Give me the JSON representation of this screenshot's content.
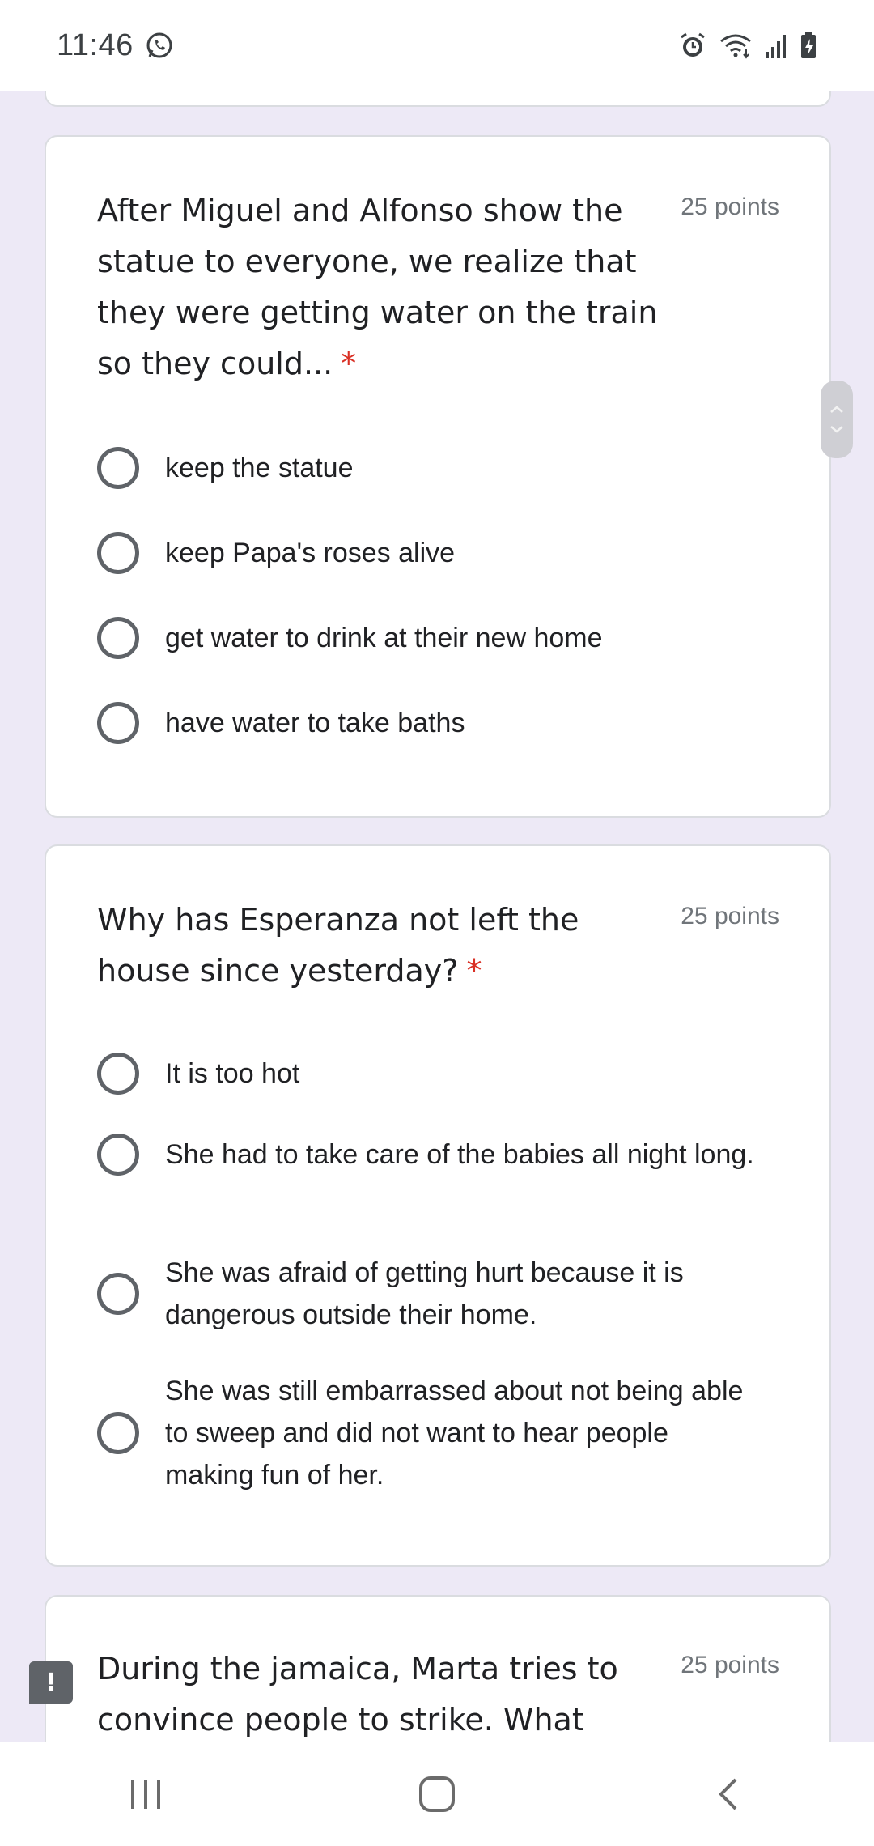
{
  "status_bar": {
    "time": "11:46",
    "left_icons": [
      "whatsapp-icon"
    ],
    "right_icons": [
      "alarm-icon",
      "wifi-icon",
      "signal-icon",
      "battery-charging-icon"
    ]
  },
  "questions": [
    {
      "title": "After Miguel and Alfonso show the statue to everyone, we realize that they were getting water on the train so they could...",
      "required_mark": "*",
      "points": "25 points",
      "options": [
        "keep the statue",
        "keep Papa's roses alive",
        "get water to drink at their new home",
        "have water to take baths"
      ]
    },
    {
      "title": "Why has Esperanza not left the house since yesterday?",
      "required_mark": "*",
      "points": "25 points",
      "options": [
        "It is too hot",
        "She had to take care of the babies all night long.",
        "She was afraid of getting hurt because it is dangerous outside their home.",
        "She was still embarrassed about not being able to sweep and did not want to hear people making fun of her."
      ]
    },
    {
      "title": "During the jamaica, Marta tries to convince people to strike. What",
      "points": "25 points"
    }
  ],
  "feedback_button": {
    "icon": "feedback-icon",
    "glyph": "!"
  },
  "nav_bar": {
    "buttons": [
      "recent-apps-icon",
      "home-icon",
      "back-icon"
    ]
  },
  "colors": {
    "background": "#ede9f6",
    "required": "#d93025",
    "radio": "#5f6368"
  }
}
